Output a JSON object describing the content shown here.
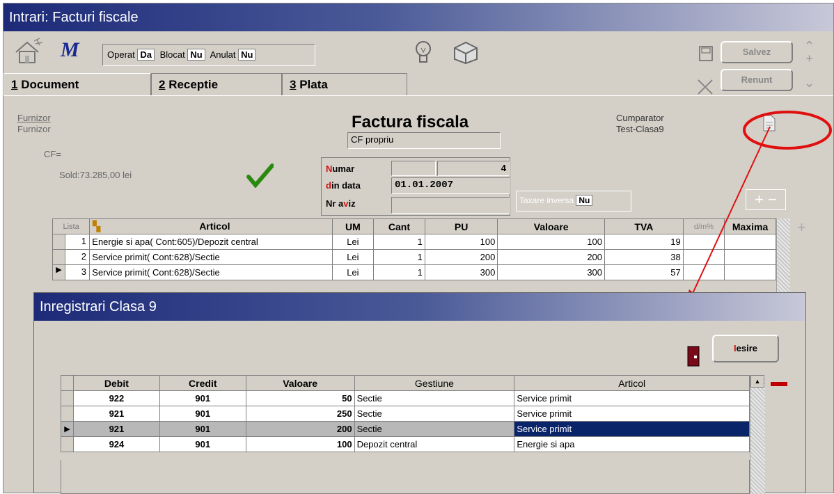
{
  "window": {
    "title": "Intrari: Facturi fiscale"
  },
  "toolbar": {
    "operat_label": "Operat",
    "operat_value": "Da",
    "blocat_label": "Blocat",
    "blocat_value": "Nu",
    "anulat_label": "Anulat",
    "anulat_value": "Nu",
    "save_label": "Salvez",
    "cancel_label": "Renunt"
  },
  "tabs": [
    {
      "num": "1",
      "label": "Document"
    },
    {
      "num": "2",
      "label": "Receptie"
    },
    {
      "num": "3",
      "label": "Plata"
    }
  ],
  "document": {
    "furnizor_label": "Furnizor",
    "furnizor_value": "Furnizor",
    "cf": "CF=",
    "sold": "Sold:73.285,00 lei",
    "title": "Factura fiscala",
    "cf_propriu": "CF propriu",
    "cumparator_label": "Cumparator",
    "cumparator_value": "Test-Clasa9",
    "numar_label_n": "N",
    "numar_label_rest": "umar",
    "numar_value": "4",
    "data_label_d": "d",
    "data_label_rest": "in data",
    "data_value": "01.01.2007",
    "aviz_label_a": "Nr a",
    "aviz_label_v": "v",
    "aviz_label_rest": "iz",
    "taxare_label": "Taxare inversa",
    "taxare_value": "Nu"
  },
  "items_table": {
    "headers": [
      "Lista",
      "Articol",
      "UM",
      "Cant",
      "PU",
      "Valoare",
      "TVA",
      "d/m%",
      "Maxima"
    ],
    "rows": [
      {
        "nr": "1",
        "articol": "Energie si apa( Cont:605)/Depozit central",
        "um": "Lei",
        "cant": "1",
        "pu": "100",
        "valoare": "100",
        "tva": "19"
      },
      {
        "nr": "2",
        "articol": "Service primit( Cont:628)/Sectie",
        "um": "Lei",
        "cant": "1",
        "pu": "200",
        "valoare": "200",
        "tva": "38"
      },
      {
        "nr": "3",
        "articol": "Service primit( Cont:628)/Sectie",
        "um": "Lei",
        "cant": "1",
        "pu": "300",
        "valoare": "300",
        "tva": "57"
      }
    ]
  },
  "modal": {
    "title": "Inregistrari Clasa 9",
    "exit_label_i": "I",
    "exit_label_rest": "esire",
    "headers": [
      "Debit",
      "Credit",
      "Valoare",
      "Gestiune",
      "Articol"
    ],
    "rows": [
      {
        "debit": "922",
        "credit": "901",
        "valoare": "50",
        "gestiune": "Sectie",
        "articol": "Service primit"
      },
      {
        "debit": "921",
        "credit": "901",
        "valoare": "250",
        "gestiune": "Sectie",
        "articol": "Service primit"
      },
      {
        "debit": "921",
        "credit": "901",
        "valoare": "200",
        "gestiune": "Sectie",
        "articol": "Service primit"
      },
      {
        "debit": "924",
        "credit": "901",
        "valoare": "100",
        "gestiune": "Depozit central",
        "articol": "Energie si apa"
      }
    ]
  },
  "colors": {
    "title_bar": "#1c2a78",
    "selection": "#0a246a",
    "highlight_red": "#e01010"
  }
}
